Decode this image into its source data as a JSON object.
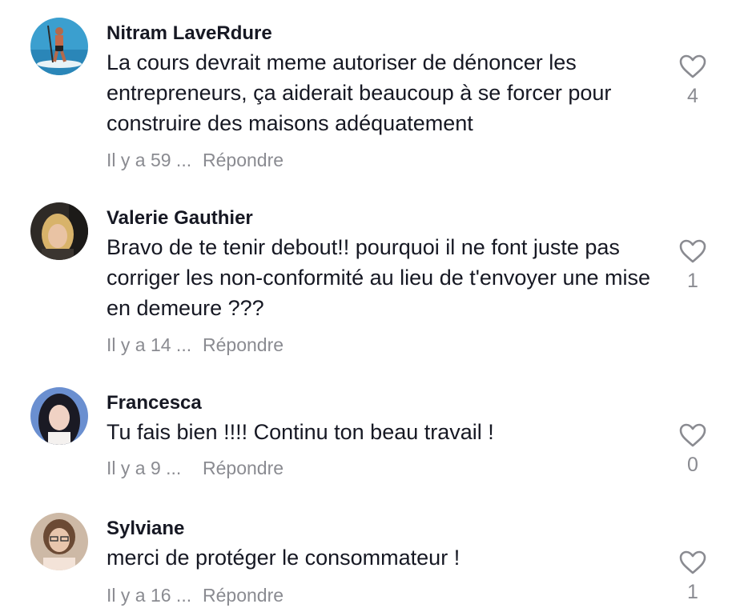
{
  "comments": [
    {
      "author": "Nitram LaveRdure",
      "text": "La cours devrait meme autoriser de dénoncer les entrepreneurs, ça aiderait beaucoup à se forcer pour construire des maisons adéquatement",
      "time": "Il y a 59 ...",
      "reply_label": "Répondre",
      "likes": "4",
      "avatar": "avatar-paddleboarder"
    },
    {
      "author": "Valerie Gauthier",
      "text": "Bravo de te tenir debout!! pourquoi il ne font juste pas corriger les non-conformité au lieu de t'envoyer une mise en demeure ???",
      "time": "Il y a 14 ...",
      "reply_label": "Répondre",
      "likes": "1",
      "avatar": "avatar-blonde-woman"
    },
    {
      "author": "Francesca",
      "text": "Tu fais bien !!!! Continu ton beau travail !",
      "time": "Il y a 9 ...",
      "reply_label": "Répondre",
      "likes": "0",
      "avatar": "avatar-dark-hair-woman"
    },
    {
      "author": "Sylviane",
      "text": "merci de protéger le consommateur !",
      "time": "Il y a 16 ...",
      "reply_label": "Répondre",
      "likes": "1",
      "avatar": "avatar-woman-glasses"
    }
  ],
  "colors": {
    "text_primary": "#161823",
    "text_secondary": "#8a8b91",
    "background": "#ffffff"
  },
  "icons": {
    "like": "heart-outline-icon"
  }
}
